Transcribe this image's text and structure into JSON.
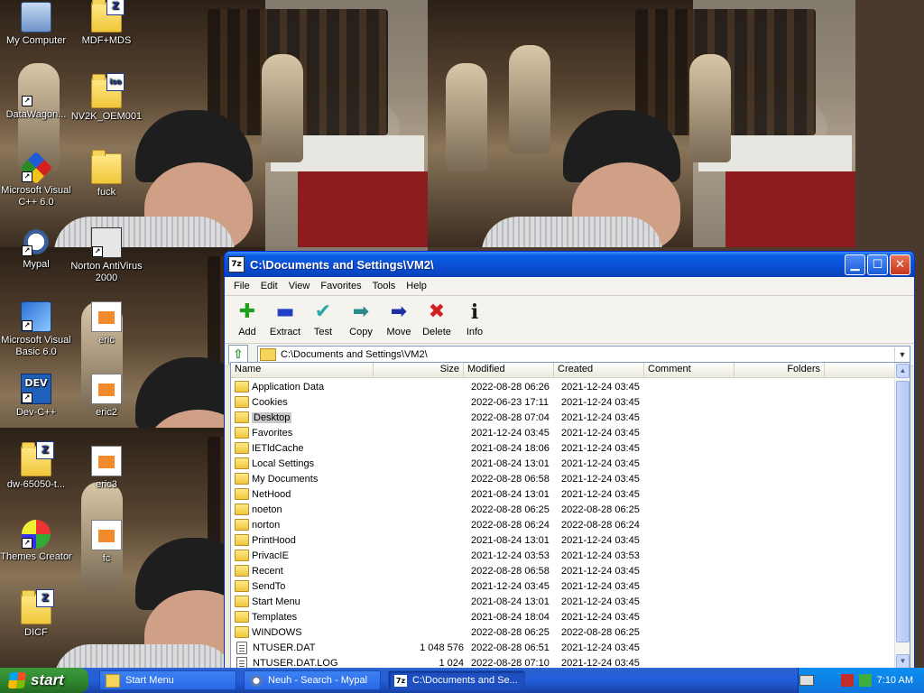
{
  "desktop": {
    "icons": [
      {
        "label": "My Computer",
        "icon": "computer-icon"
      },
      {
        "label": "MDF+MDS",
        "icon": "archive-folder-icon"
      },
      {
        "label": "DataWagon...",
        "icon": "shortcut-icon"
      },
      {
        "label": "NV2K_OEM001",
        "icon": "iso-folder-icon"
      },
      {
        "label": "Microsoft Visual C++ 6.0",
        "icon": "visual-cpp-icon"
      },
      {
        "label": "fuck",
        "icon": "folder-icon"
      },
      {
        "label": "Mypal",
        "icon": "mypal-icon"
      },
      {
        "label": "Norton AntiVirus 2000",
        "icon": "norton-icon"
      },
      {
        "label": "Microsoft Visual Basic 6.0",
        "icon": "visual-basic-icon"
      },
      {
        "label": "eric",
        "icon": "document-icon"
      },
      {
        "label": "Dev-C++",
        "icon": "dev-cpp-icon"
      },
      {
        "label": "eric2",
        "icon": "document-icon"
      },
      {
        "label": "dw-65050-t...",
        "icon": "archive-folder-icon"
      },
      {
        "label": "eric3",
        "icon": "document-icon"
      },
      {
        "label": "Themes Creator",
        "icon": "themes-creator-icon"
      },
      {
        "label": "fc",
        "icon": "document-icon"
      },
      {
        "label": "DICF",
        "icon": "archive-folder-icon"
      }
    ]
  },
  "window": {
    "title": "C:\\Documents and Settings\\VM2\\",
    "app_icon": "7z",
    "menu": [
      "File",
      "Edit",
      "View",
      "Favorites",
      "Tools",
      "Help"
    ],
    "toolbar": [
      {
        "label": "Add",
        "icon": "plus-icon",
        "color": "#1ea01e"
      },
      {
        "label": "Extract",
        "icon": "minus-icon",
        "color": "#1f3fc6"
      },
      {
        "label": "Test",
        "icon": "check-icon",
        "color": "#2aa7a7"
      },
      {
        "label": "Copy",
        "icon": "copy-arrow-icon",
        "color": "#2a8a8a"
      },
      {
        "label": "Move",
        "icon": "move-arrow-icon",
        "color": "#1f2fa6"
      },
      {
        "label": "Delete",
        "icon": "delete-icon",
        "color": "#d21e1e"
      },
      {
        "label": "Info",
        "icon": "info-icon",
        "color": "#1a1a1a"
      }
    ],
    "address": "C:\\Documents and Settings\\VM2\\",
    "columns": [
      "Name",
      "Size",
      "Modified",
      "Created",
      "Comment",
      "Folders",
      "F"
    ],
    "rows": [
      {
        "name": "Application Data",
        "size": "",
        "modified": "2022-08-28 06:26",
        "created": "2021-12-24 03:45",
        "type": "folder"
      },
      {
        "name": "Cookies",
        "size": "",
        "modified": "2022-06-23 17:11",
        "created": "2021-12-24 03:45",
        "type": "folder"
      },
      {
        "name": "Desktop",
        "size": "",
        "modified": "2022-08-28 07:04",
        "created": "2021-12-24 03:45",
        "type": "folder",
        "selected": true
      },
      {
        "name": "Favorites",
        "size": "",
        "modified": "2021-12-24 03:45",
        "created": "2021-12-24 03:45",
        "type": "folder"
      },
      {
        "name": "IETldCache",
        "size": "",
        "modified": "2021-08-24 18:06",
        "created": "2021-12-24 03:45",
        "type": "folder"
      },
      {
        "name": "Local Settings",
        "size": "",
        "modified": "2021-08-24 13:01",
        "created": "2021-12-24 03:45",
        "type": "folder"
      },
      {
        "name": "My Documents",
        "size": "",
        "modified": "2022-08-28 06:58",
        "created": "2021-12-24 03:45",
        "type": "folder"
      },
      {
        "name": "NetHood",
        "size": "",
        "modified": "2021-08-24 13:01",
        "created": "2021-12-24 03:45",
        "type": "folder"
      },
      {
        "name": "noeton",
        "size": "",
        "modified": "2022-08-28 06:25",
        "created": "2022-08-28 06:25",
        "type": "folder"
      },
      {
        "name": "norton",
        "size": "",
        "modified": "2022-08-28 06:24",
        "created": "2022-08-28 06:24",
        "type": "folder"
      },
      {
        "name": "PrintHood",
        "size": "",
        "modified": "2021-08-24 13:01",
        "created": "2021-12-24 03:45",
        "type": "folder"
      },
      {
        "name": "PrivacIE",
        "size": "",
        "modified": "2021-12-24 03:53",
        "created": "2021-12-24 03:53",
        "type": "folder"
      },
      {
        "name": "Recent",
        "size": "",
        "modified": "2022-08-28 06:58",
        "created": "2021-12-24 03:45",
        "type": "folder"
      },
      {
        "name": "SendTo",
        "size": "",
        "modified": "2021-12-24 03:45",
        "created": "2021-12-24 03:45",
        "type": "folder"
      },
      {
        "name": "Start Menu",
        "size": "",
        "modified": "2021-08-24 13:01",
        "created": "2021-12-24 03:45",
        "type": "folder"
      },
      {
        "name": "Templates",
        "size": "",
        "modified": "2021-08-24 18:04",
        "created": "2021-12-24 03:45",
        "type": "folder"
      },
      {
        "name": "WINDOWS",
        "size": "",
        "modified": "2022-08-28 06:25",
        "created": "2022-08-28 06:25",
        "type": "folder"
      },
      {
        "name": "NTUSER.DAT",
        "size": "1 048 576",
        "modified": "2022-08-28 06:51",
        "created": "2021-12-24 03:45",
        "type": "file"
      },
      {
        "name": "NTUSER.DAT.LOG",
        "size": "1 024",
        "modified": "2022-08-28 07:10",
        "created": "2021-12-24 03:45",
        "type": "file"
      }
    ]
  },
  "taskbar": {
    "start_label": "start",
    "tasks": [
      {
        "label": "Start Menu",
        "icon": "folder-icon",
        "active": false
      },
      {
        "label": "Neuh - Search - Mypal",
        "icon": "mypal-icon",
        "active": false
      },
      {
        "label": "C:\\Documents and Se...",
        "icon": "sevenzip-icon",
        "active": true
      }
    ],
    "clock": "7:10 AM"
  }
}
